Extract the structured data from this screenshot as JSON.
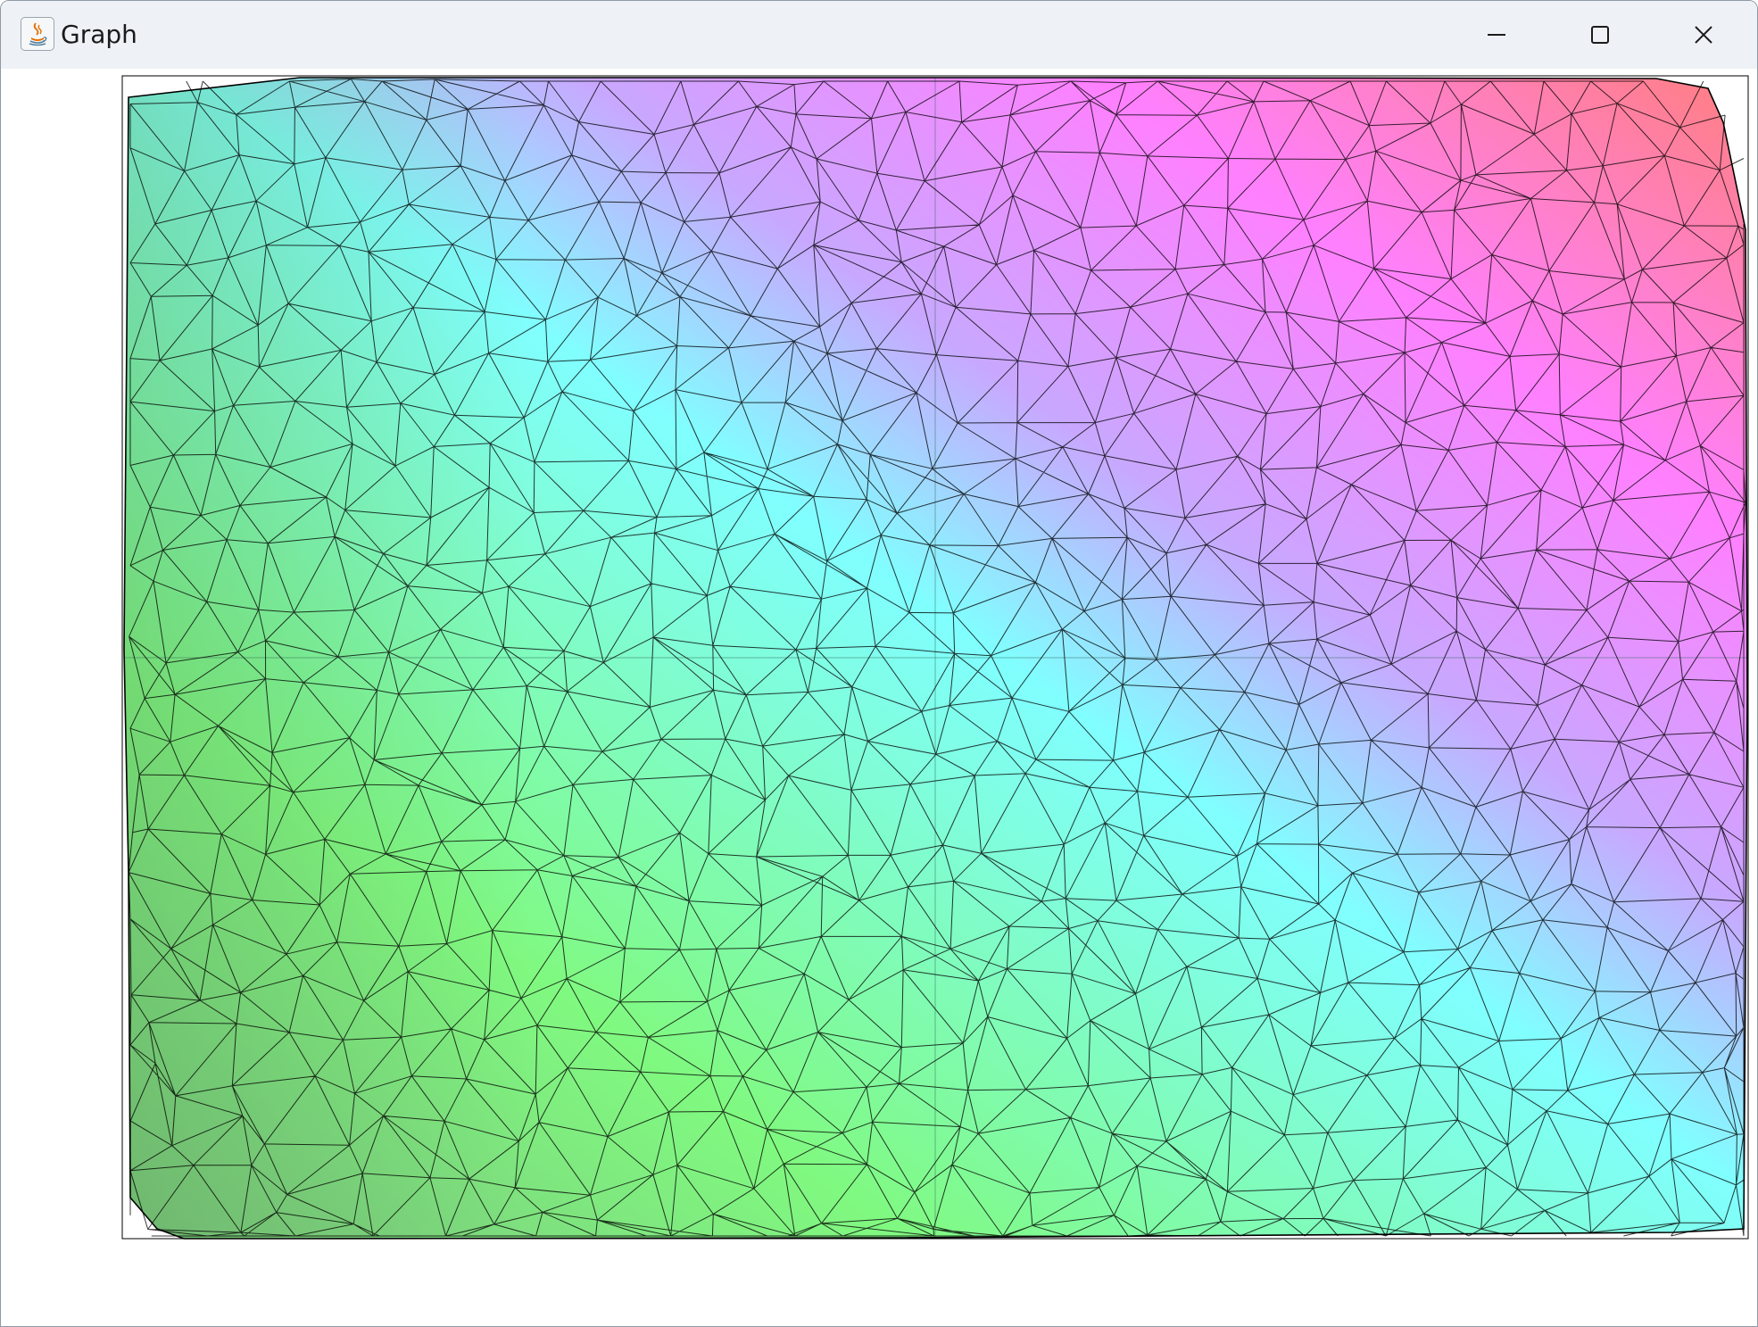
{
  "window": {
    "title": "Graph",
    "app_icon": "java-coffee-cup-icon",
    "controls": {
      "minimize_icon": "minimize-icon",
      "maximize_icon": "maximize-icon",
      "close_icon": "close-icon"
    }
  },
  "plot": {
    "type": "triangulated-mesh",
    "mesh_stroke_color": "#000000",
    "frame_color": "#000000",
    "background": "#ffffff",
    "color_gradient": {
      "left_edge": "#7cc47c",
      "green_band": "#80f980",
      "cyan_band": "#80ffff",
      "violet_band": "#c8a8ff",
      "magenta_band": "#ff80ff",
      "top_right_corner": "#ff7f7f"
    },
    "axis_lines": {
      "vertical_divider": true,
      "horizontal_divider": true
    }
  }
}
